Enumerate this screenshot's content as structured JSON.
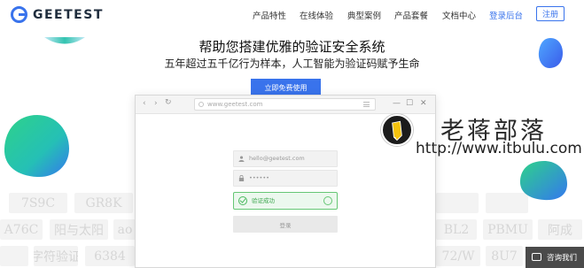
{
  "logo": {
    "text": "GEETEST"
  },
  "nav": {
    "items": [
      "产品特性",
      "在线体验",
      "典型案例",
      "产品套餐",
      "文档中心"
    ],
    "login": "登录后台",
    "register": "注册"
  },
  "hero": {
    "title": "帮助您搭建优雅的验证安全系统",
    "subtitle": "五年超过五千亿行为样本，人工智能为验证码赋予生命",
    "cta": "立即免费使用"
  },
  "browser": {
    "nav_back": "‹",
    "nav_forward": "›",
    "nav_refresh": "↻",
    "url": "www.geetest.com",
    "win_min": "—",
    "win_max": "☐",
    "win_close": "✕",
    "email_placeholder": "hello@geetest.com",
    "password_value": "••••••",
    "verify_text": "验证成功",
    "submit_label": "登录"
  },
  "ghost_captcha": {
    "row1": [
      "7S9C",
      "GR8K",
      "",
      "",
      "",
      "",
      "",
      "",
      "",
      ""
    ],
    "row2": [
      "A76C",
      "阳与太阳",
      "ao",
      "",
      "",
      "",
      "",
      "",
      "BL2",
      "PBMU",
      "阿成"
    ],
    "row3": [
      "",
      "字符验证",
      "6384",
      "",
      "",
      "",
      "",
      "",
      "",
      "72/W",
      "8U7"
    ]
  },
  "watermark": {
    "site_name": "老蒋部落",
    "site_url": "http://www.itbulu.com"
  },
  "consult": {
    "label": "咨询我们"
  },
  "colors": {
    "brand_blue": "#3973ec",
    "success_green": "#4cb960"
  }
}
